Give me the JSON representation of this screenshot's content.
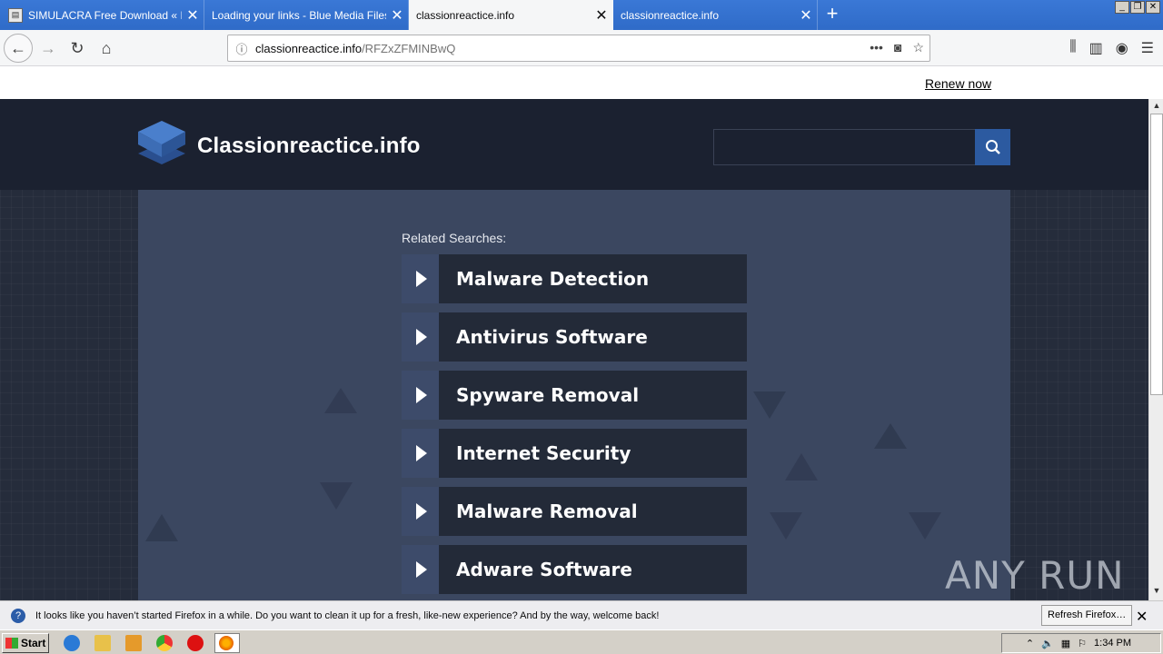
{
  "browser": {
    "tabs": [
      {
        "title": "SIMULACRA Free Download « IGG",
        "has_favicon": true,
        "active": false
      },
      {
        "title": "Loading your links - Blue Media Files",
        "has_favicon": false,
        "active": false
      },
      {
        "title": "classionreactice.info",
        "has_favicon": false,
        "active": true
      },
      {
        "title": "classionreactice.info",
        "has_favicon": false,
        "active": false
      }
    ],
    "url_host": "classionreactice.info",
    "url_path": "/RFZxZFMINBwQ"
  },
  "page": {
    "renew_link": "Renew now",
    "site_name": "Classionreactice.info",
    "related_label": "Related Searches:",
    "results": [
      "Malware Detection",
      "Antivirus Software",
      "Spyware Removal",
      "Internet Security",
      "Malware Removal",
      "Adware Software"
    ],
    "watermark": "ANY RUN"
  },
  "notification": {
    "message": "It looks like you haven’t started Firefox in a while. Do you want to clean it up for a fresh, like-new experience? And by the way, welcome back!",
    "button": "Refresh Firefox…"
  },
  "taskbar": {
    "start_label": "Start",
    "clock": "1:34 PM"
  },
  "colors": {
    "tab_bar": "#2f6bc8",
    "header_bg": "#1b2130",
    "panel_bg": "#3b4760",
    "result_bg": "#232a38",
    "search_button": "#2c5aa0"
  }
}
